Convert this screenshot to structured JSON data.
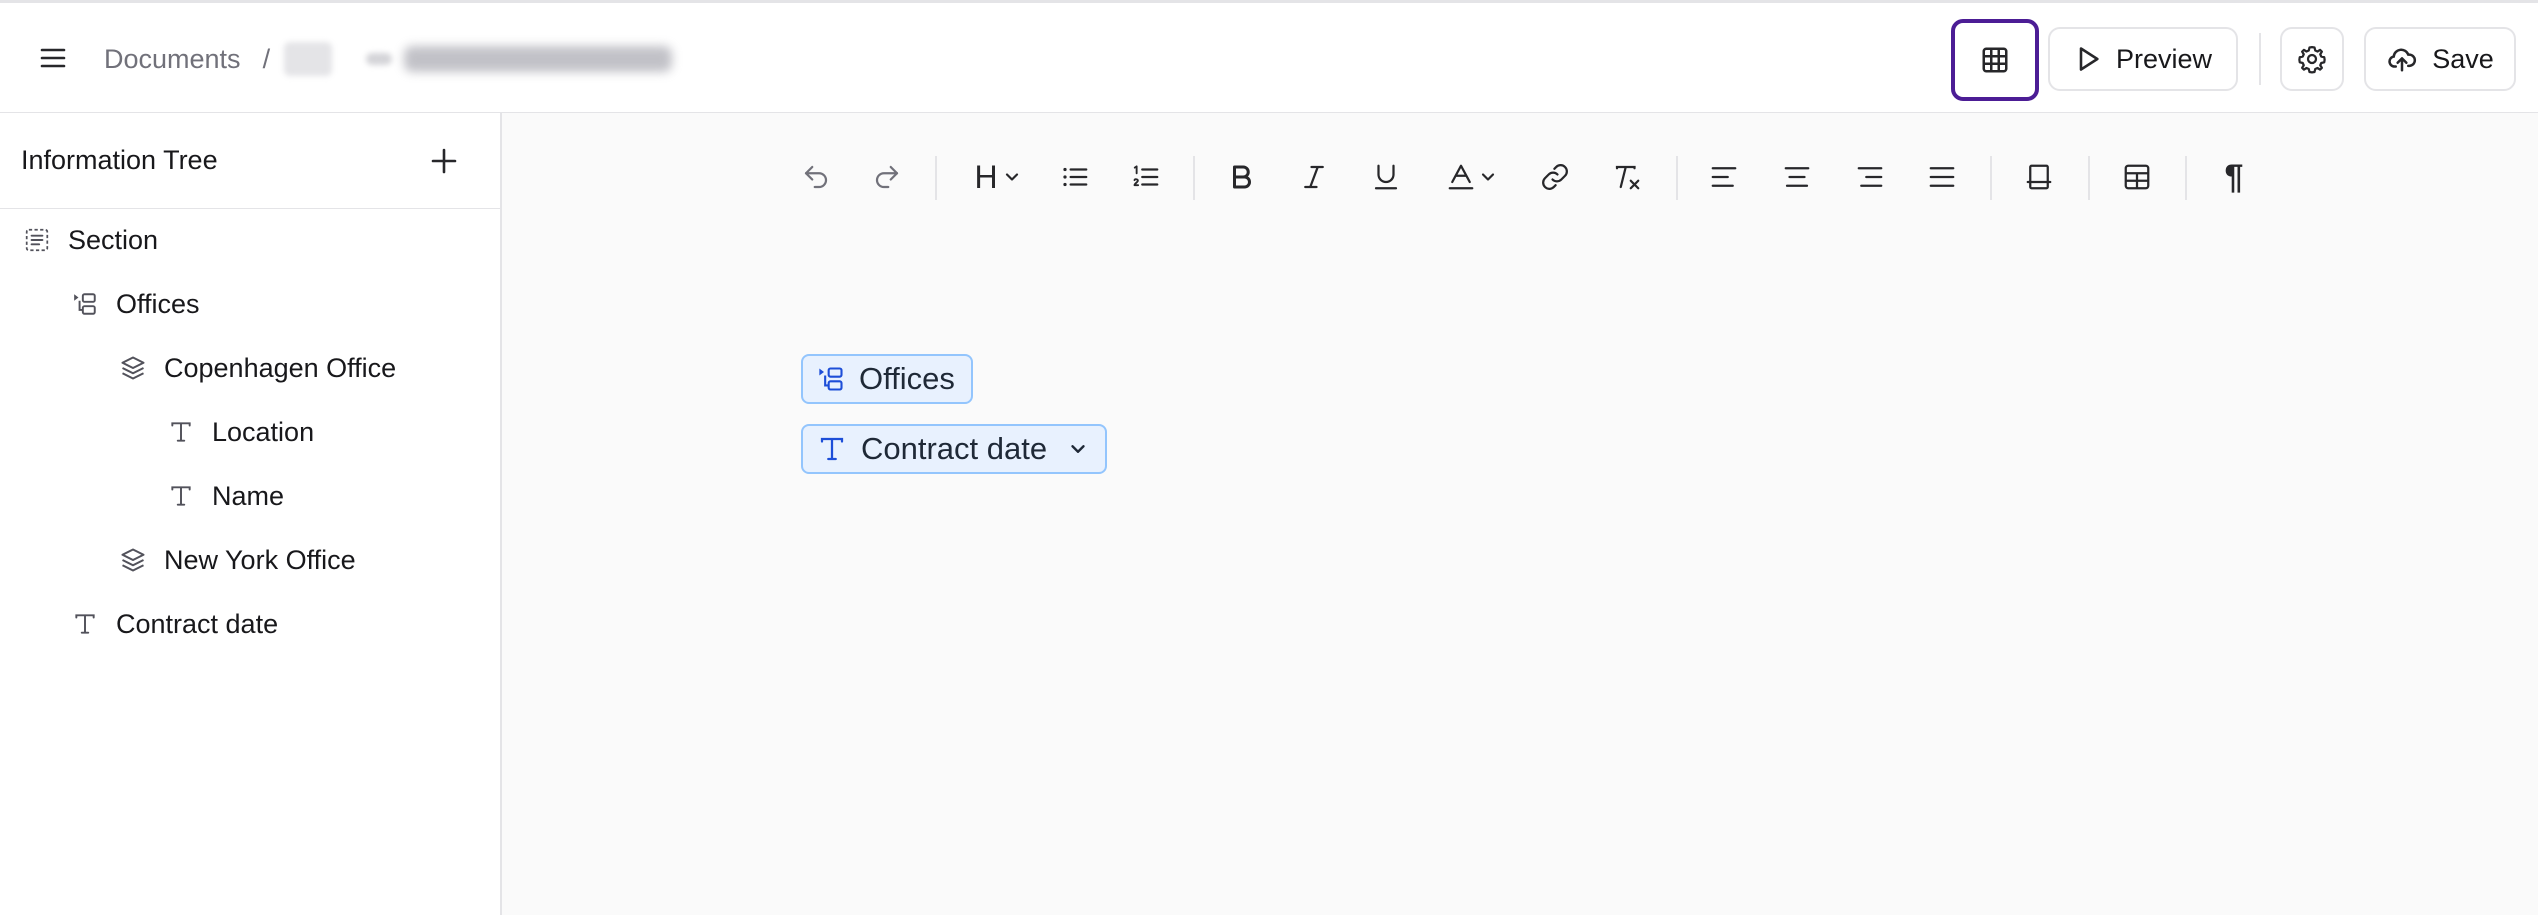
{
  "colors": {
    "accent": "#4c1d95",
    "chip_bg": "#e8f1fe",
    "chip_border": "#93c5fd",
    "chip_icon": "#1d4ed8"
  },
  "header": {
    "breadcrumb_root": "Documents",
    "breadcrumb_separator": "/",
    "preview_label": "Preview",
    "save_label": "Save"
  },
  "sidebar": {
    "title": "Information Tree",
    "items": [
      {
        "label": "Section",
        "icon": "section-icon"
      },
      {
        "label": "Offices",
        "icon": "repeater-icon"
      },
      {
        "label": "Copenhagen Office",
        "icon": "layers-icon"
      },
      {
        "label": "Location",
        "icon": "text-type-icon"
      },
      {
        "label": "Name",
        "icon": "text-type-icon"
      },
      {
        "label": "New York Office",
        "icon": "layers-icon"
      },
      {
        "label": "Contract date",
        "icon": "text-type-icon"
      }
    ]
  },
  "toolbar": {
    "heading_label": "H",
    "paragraph_mark": "¶"
  },
  "editor": {
    "chips": [
      {
        "label": "Offices",
        "icon": "repeater-icon"
      },
      {
        "label": "Contract date",
        "icon": "text-type-icon"
      }
    ]
  }
}
